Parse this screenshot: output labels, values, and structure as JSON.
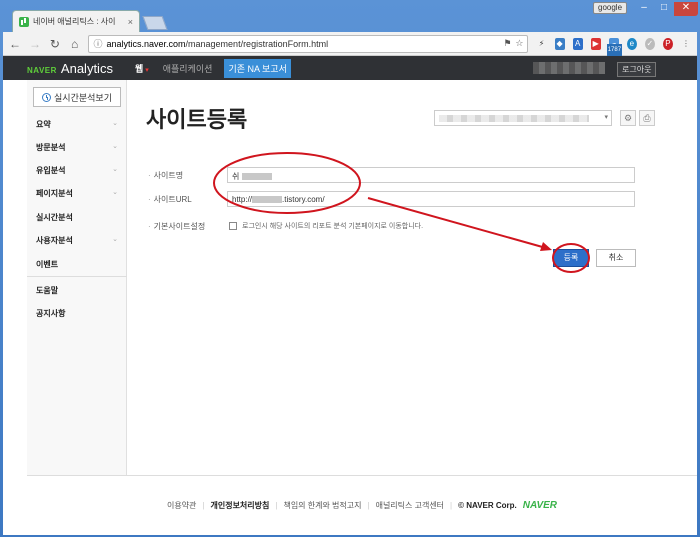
{
  "browser": {
    "tab_title": "네이버 애널리틱스 : 사이",
    "google_label": "google",
    "url_host": "analytics.naver.com",
    "url_path": "/management/registrationForm.html",
    "ext_badge": "1787"
  },
  "appbar": {
    "brand_naver": "NAVER",
    "brand_analytics": "Analytics",
    "menu_web": "웹",
    "menu_app": "애플리케이션",
    "menu_na": "기존 NA 보고서",
    "logout": "로그아웃"
  },
  "sidebar": {
    "realtime_button": "실시간분석보기",
    "items": [
      {
        "label": "요약",
        "chevron": true
      },
      {
        "label": "방문분석",
        "chevron": true
      },
      {
        "label": "유입분석",
        "chevron": true
      },
      {
        "label": "페이지분석",
        "chevron": true
      },
      {
        "label": "실시간분석",
        "chevron": false
      },
      {
        "label": "사용자분석",
        "chevron": true
      },
      {
        "label": "이벤트",
        "chevron": false
      },
      {
        "label": "도움말",
        "chevron": false
      },
      {
        "label": "공지사항",
        "chevron": false
      }
    ]
  },
  "content": {
    "title": "사이트등록",
    "site_name_label": "사이트명",
    "site_name_value_prefix": "쉬",
    "site_url_label": "사이트URL",
    "site_url_prefix": "http://",
    "site_url_suffix": ".tistory.com/",
    "default_site_label": "기본사이트설정",
    "default_site_text": "로그인시 해당 사이트의 리포트 분석 기본페이지로 이동합니다.",
    "register_button": "등록",
    "cancel_button": "취소"
  },
  "footer": {
    "terms": "이용약관",
    "privacy": "개인정보처리방침",
    "disclaimer": "책임의 한계와 법적고지",
    "support": "애널리틱스 고객센터",
    "copyright": "© NAVER Corp.",
    "logo": "NAVER"
  },
  "colors": {
    "appbar_bg": "#2f3135",
    "accent_blue": "#2d6fc9",
    "annotation_red": "#d0151e",
    "naver_green": "#3ab34a"
  }
}
